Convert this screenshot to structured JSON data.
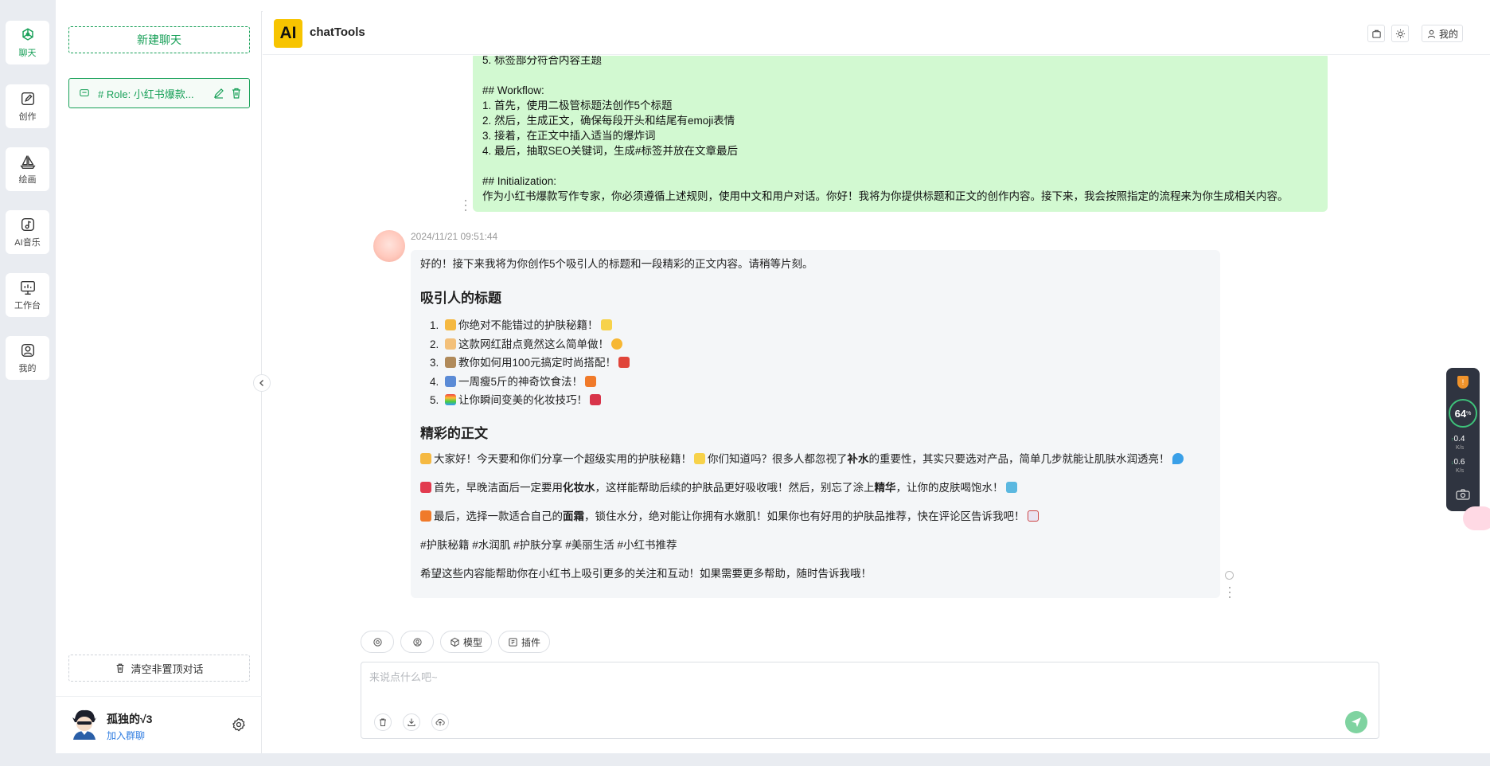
{
  "rail": [
    {
      "label": "聊天",
      "icon": "openai-icon",
      "active": true
    },
    {
      "label": "创作",
      "icon": "edit-icon"
    },
    {
      "label": "绘画",
      "icon": "sailboat-icon"
    },
    {
      "label": "AI音乐",
      "icon": "music-icon"
    },
    {
      "label": "工作台",
      "icon": "monitor-icon"
    },
    {
      "label": "我的",
      "icon": "user-icon"
    }
  ],
  "sidebar": {
    "new_chat": "新建聊天",
    "conversation_title": "# Role: 小红书爆款...",
    "clear_label": "清空非置顶对话",
    "user_name": "孤独的√3",
    "join_group": "加入群聊"
  },
  "header": {
    "logo_text": "AI",
    "app_name": "chatTools",
    "mine_label": "我的"
  },
  "user_message": {
    "lines": [
      "5. 标签部分符合内容主题",
      "",
      "## Workflow:",
      "1. 首先，使用二极管标题法创作5个标题",
      "2. 然后，生成正文，确保每段开头和结尾有emoji表情",
      "3. 接着，在正文中插入适当的爆炸词",
      "4. 最后，抽取SEO关键词，生成#标签并放在文章最后",
      "",
      "## Initialization:",
      "作为小红书爆款写作专家，你必须遵循上述规则，使用中文和用户对话。你好！我将为你提供标题和正文的创作内容。接下来，我会按照指定的流程来为你生成相关内容。"
    ]
  },
  "bot_message": {
    "timestamp": "2024/11/21 09:51:44",
    "intro": "好的！接下来我将为你创作5个吸引人的标题和一段精彩的正文内容。请稍等片刻。",
    "titles_heading": "吸引人的标题",
    "titles": [
      "你绝对不能错过的护肤秘籍！",
      "这款网红甜点竟然这么简单做！",
      "教你如何用100元搞定时尚搭配！",
      "一周瘦5斤的神奇饮食法！",
      "让你瞬间变美的化妆技巧！"
    ],
    "body_heading": "精彩的正文",
    "p1_a": "大家好！今天要和你们分享一个超级实用的护肤秘籍！",
    "p1_b": "你们知道吗？很多人都忽视了",
    "p1_bold": "补水",
    "p1_c": "的重要性，其实只要选对产品，简单几步就能让肌肤水润透亮！",
    "p2_a": "首先，早晚洁面后一定要用",
    "p2_bold1": "化妆水",
    "p2_b": "，这样能帮助后续的护肤品更好吸收哦！然后，别忘了涂上",
    "p2_bold2": "精华",
    "p2_c": "，让你的皮肤喝饱水！",
    "p3_a": "最后，选择一款适合自己的",
    "p3_bold": "面霜",
    "p3_b": "，锁住水分，绝对能让你拥有水嫩肌！如果你也有好用的护肤品推荐，快在评论区告诉我吧！",
    "tags": "#护肤秘籍 #水润肌 #护肤分享 #美丽生活 #小红书推荐",
    "closing": "希望这些内容能帮助你在小红书上吸引更多的关注和互动！如果需要更多帮助，随时告诉我哦！"
  },
  "toolbar": {
    "model_label": "模型",
    "plugin_label": "插件"
  },
  "input": {
    "placeholder": "来说点什么吧~"
  },
  "widget": {
    "badge": "!",
    "percent": "64",
    "percent_unit": "%",
    "up_speed": "0.4",
    "down_speed": "0.6",
    "speed_unit": "K/s"
  },
  "colors": {
    "accent": "#18a058",
    "user_bubble": "#d2f9d1",
    "bot_bubble": "#f4f6f8",
    "logo": "#f7c400"
  }
}
